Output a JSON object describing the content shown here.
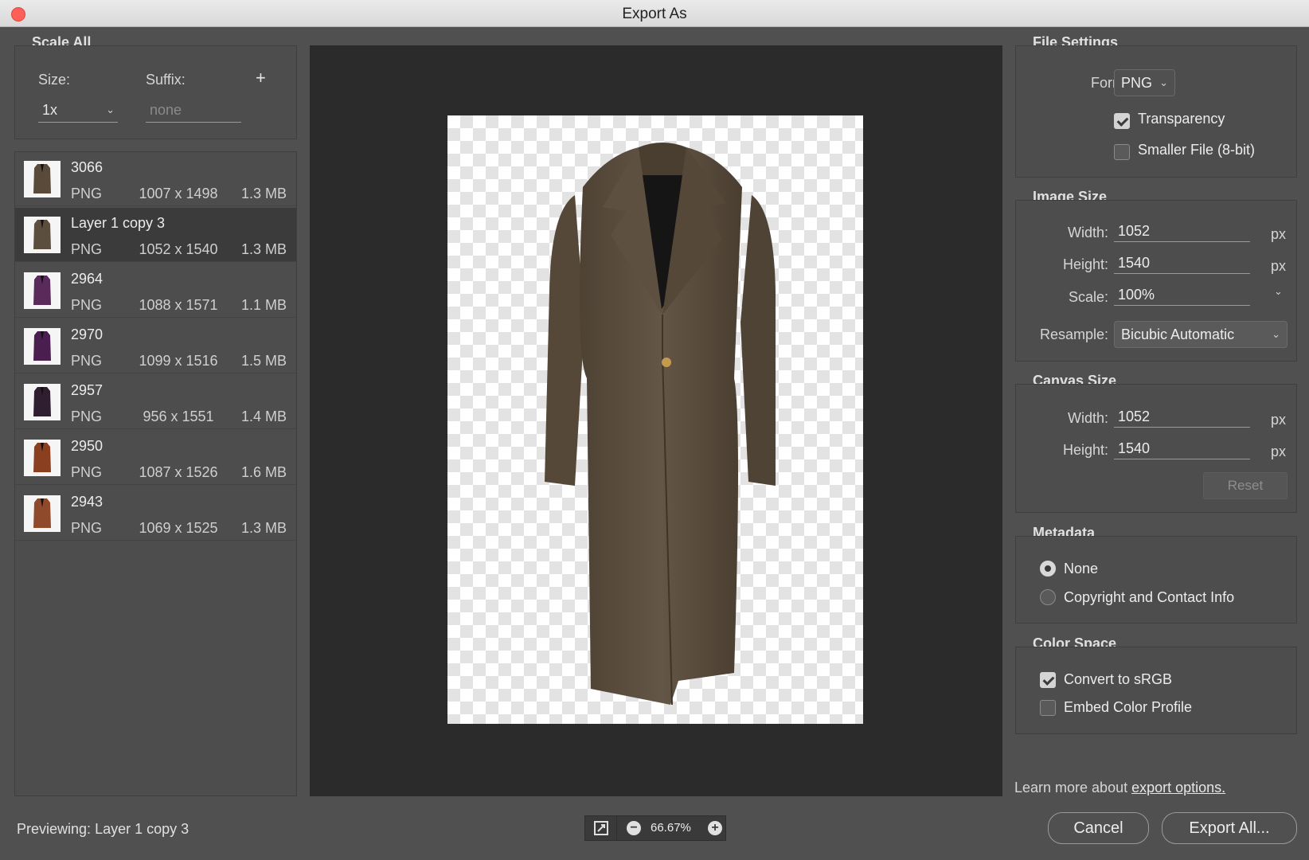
{
  "window": {
    "title": "Export As"
  },
  "scale_all": {
    "heading": "Scale All",
    "size_label": "Size:",
    "suffix_label": "Suffix:",
    "size_value": "1x",
    "suffix_placeholder": "none",
    "add_icon": "plus-icon"
  },
  "assets": [
    {
      "name": "3066",
      "format": "PNG",
      "dims": "1007 x 1498",
      "size": "1.3 MB",
      "color": "#5a4a3a"
    },
    {
      "name": "Layer 1 copy 3",
      "format": "PNG",
      "dims": "1052 x 1540",
      "size": "1.3 MB",
      "color": "#5c4e3e"
    },
    {
      "name": "2964",
      "format": "PNG",
      "dims": "1088 x 1571",
      "size": "1.1 MB",
      "color": "#5a2a5a"
    },
    {
      "name": "2970",
      "format": "PNG",
      "dims": "1099 x 1516",
      "size": "1.5 MB",
      "color": "#4a1f50"
    },
    {
      "name": "2957",
      "format": "PNG",
      "dims": "956 x 1551",
      "size": "1.4 MB",
      "color": "#2e1e30"
    },
    {
      "name": "2950",
      "format": "PNG",
      "dims": "1087 x 1526",
      "size": "1.6 MB",
      "color": "#8a4020"
    },
    {
      "name": "2943",
      "format": "PNG",
      "dims": "1069 x 1525",
      "size": "1.3 MB",
      "color": "#8e4a2a"
    }
  ],
  "file_settings": {
    "heading": "File Settings",
    "format_label": "Format:",
    "format_value": "PNG",
    "transparency_label": "Transparency",
    "transparency_checked": true,
    "smaller_label": "Smaller File (8-bit)",
    "smaller_checked": false
  },
  "image_size": {
    "heading": "Image Size",
    "width_label": "Width:",
    "width_value": "1052",
    "height_label": "Height:",
    "height_value": "1540",
    "scale_label": "Scale:",
    "scale_value": "100%",
    "resample_label": "Resample:",
    "resample_value": "Bicubic Automatic",
    "unit": "px"
  },
  "canvas_size": {
    "heading": "Canvas Size",
    "width_label": "Width:",
    "width_value": "1052",
    "height_label": "Height:",
    "height_value": "1540",
    "unit": "px",
    "reset_label": "Reset"
  },
  "metadata": {
    "heading": "Metadata",
    "options": [
      "None",
      "Copyright and Contact Info"
    ],
    "selected": "None"
  },
  "color_space": {
    "heading": "Color Space",
    "convert_label": "Convert to sRGB",
    "convert_checked": true,
    "embed_label": "Embed Color Profile",
    "embed_checked": false
  },
  "footer": {
    "learn_more": "Learn more about ",
    "learn_link": "export options.",
    "previewing_label": "Previewing:",
    "previewing_value": "Layer 1 copy 3",
    "zoom": "66.67%",
    "cancel_label": "Cancel",
    "export_label": "Export All..."
  },
  "colors": {
    "accent_bg": "#505050",
    "preview_bg": "#2b2b2b",
    "coat": "#5c4e3e"
  }
}
